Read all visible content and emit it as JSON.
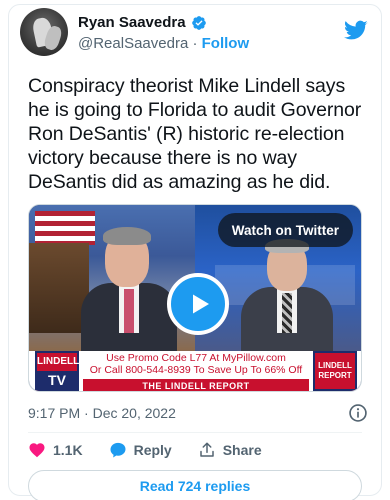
{
  "author": {
    "name": "Ryan Saavedra",
    "handle": "@RealSaavedra",
    "separator": "·",
    "follow_label": "Follow"
  },
  "tweet": {
    "text": "Conspiracy theorist Mike Lindell says he is going to Florida to audit Governor Ron DeSantis' (R) historic re-election victory because there is no way DeSantis did as amazing as he did.",
    "time": "9:17 PM",
    "date": "Dec 20, 2022"
  },
  "media": {
    "watch_label": "Watch on Twitter",
    "banner": {
      "logo_left": "LINDELL",
      "logo_left_sub": "TV",
      "logo_right": "LINDELL REPORT",
      "promo_line1": "Use Promo Code L77 At MyPillow.com",
      "promo_line2": "Or Call 800-544-8939 To Save Up To 66% Off",
      "footer": "THE LINDELL REPORT"
    }
  },
  "actions": {
    "like_count": "1.1K",
    "reply_label": "Reply",
    "share_label": "Share"
  },
  "replies_button": "Read 724 replies",
  "icons": {
    "verified": "verified-badge-icon",
    "twitter": "twitter-bird-icon",
    "play": "play-icon",
    "info": "info-icon",
    "heart": "heart-icon",
    "reply": "reply-bubble-icon",
    "share": "share-upload-icon"
  },
  "colors": {
    "accent": "#1d9bf0",
    "heart": "#f91880",
    "text_secondary": "#536471"
  }
}
